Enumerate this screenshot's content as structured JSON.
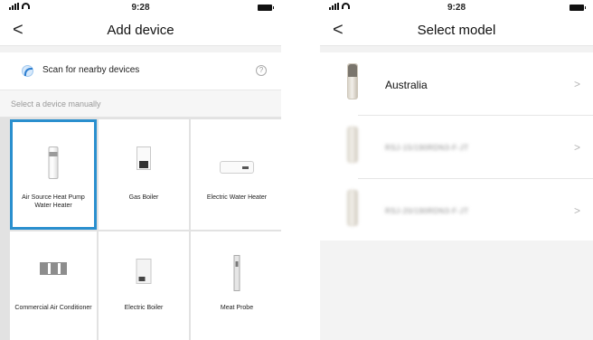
{
  "left_screen": {
    "status": {
      "time": "9:28"
    },
    "title": "Add device",
    "back_glyph": "<",
    "scan": {
      "label": "Scan for nearby devices",
      "help_glyph": "?"
    },
    "section_label": "Select a device manually",
    "devices": [
      {
        "label": "Air Source Heat Pump Water Heater",
        "icon": "heat-pump-icon",
        "selected": true
      },
      {
        "label": "Gas Boiler",
        "icon": "gas-boiler-icon"
      },
      {
        "label": "Electric Water Heater",
        "icon": "electric-water-heater-icon"
      },
      {
        "label": "Commercial Air Conditioner",
        "icon": "air-conditioner-icon"
      },
      {
        "label": "Electric Boiler",
        "icon": "electric-boiler-icon"
      },
      {
        "label": "Meat Probe",
        "icon": "meat-probe-icon"
      }
    ],
    "accent_color": "#2a8fce"
  },
  "right_screen": {
    "status": {
      "time": "9:28"
    },
    "title": "Select model",
    "back_glyph": "<",
    "models": [
      {
        "name": "Australia",
        "chevron": ">"
      },
      {
        "name": "RSJ-15/190RDN3-F-JT",
        "chevron": ">",
        "blurred": true
      },
      {
        "name": "RSJ-20/190RDN3-F-JT",
        "chevron": ">",
        "blurred": true
      }
    ]
  }
}
